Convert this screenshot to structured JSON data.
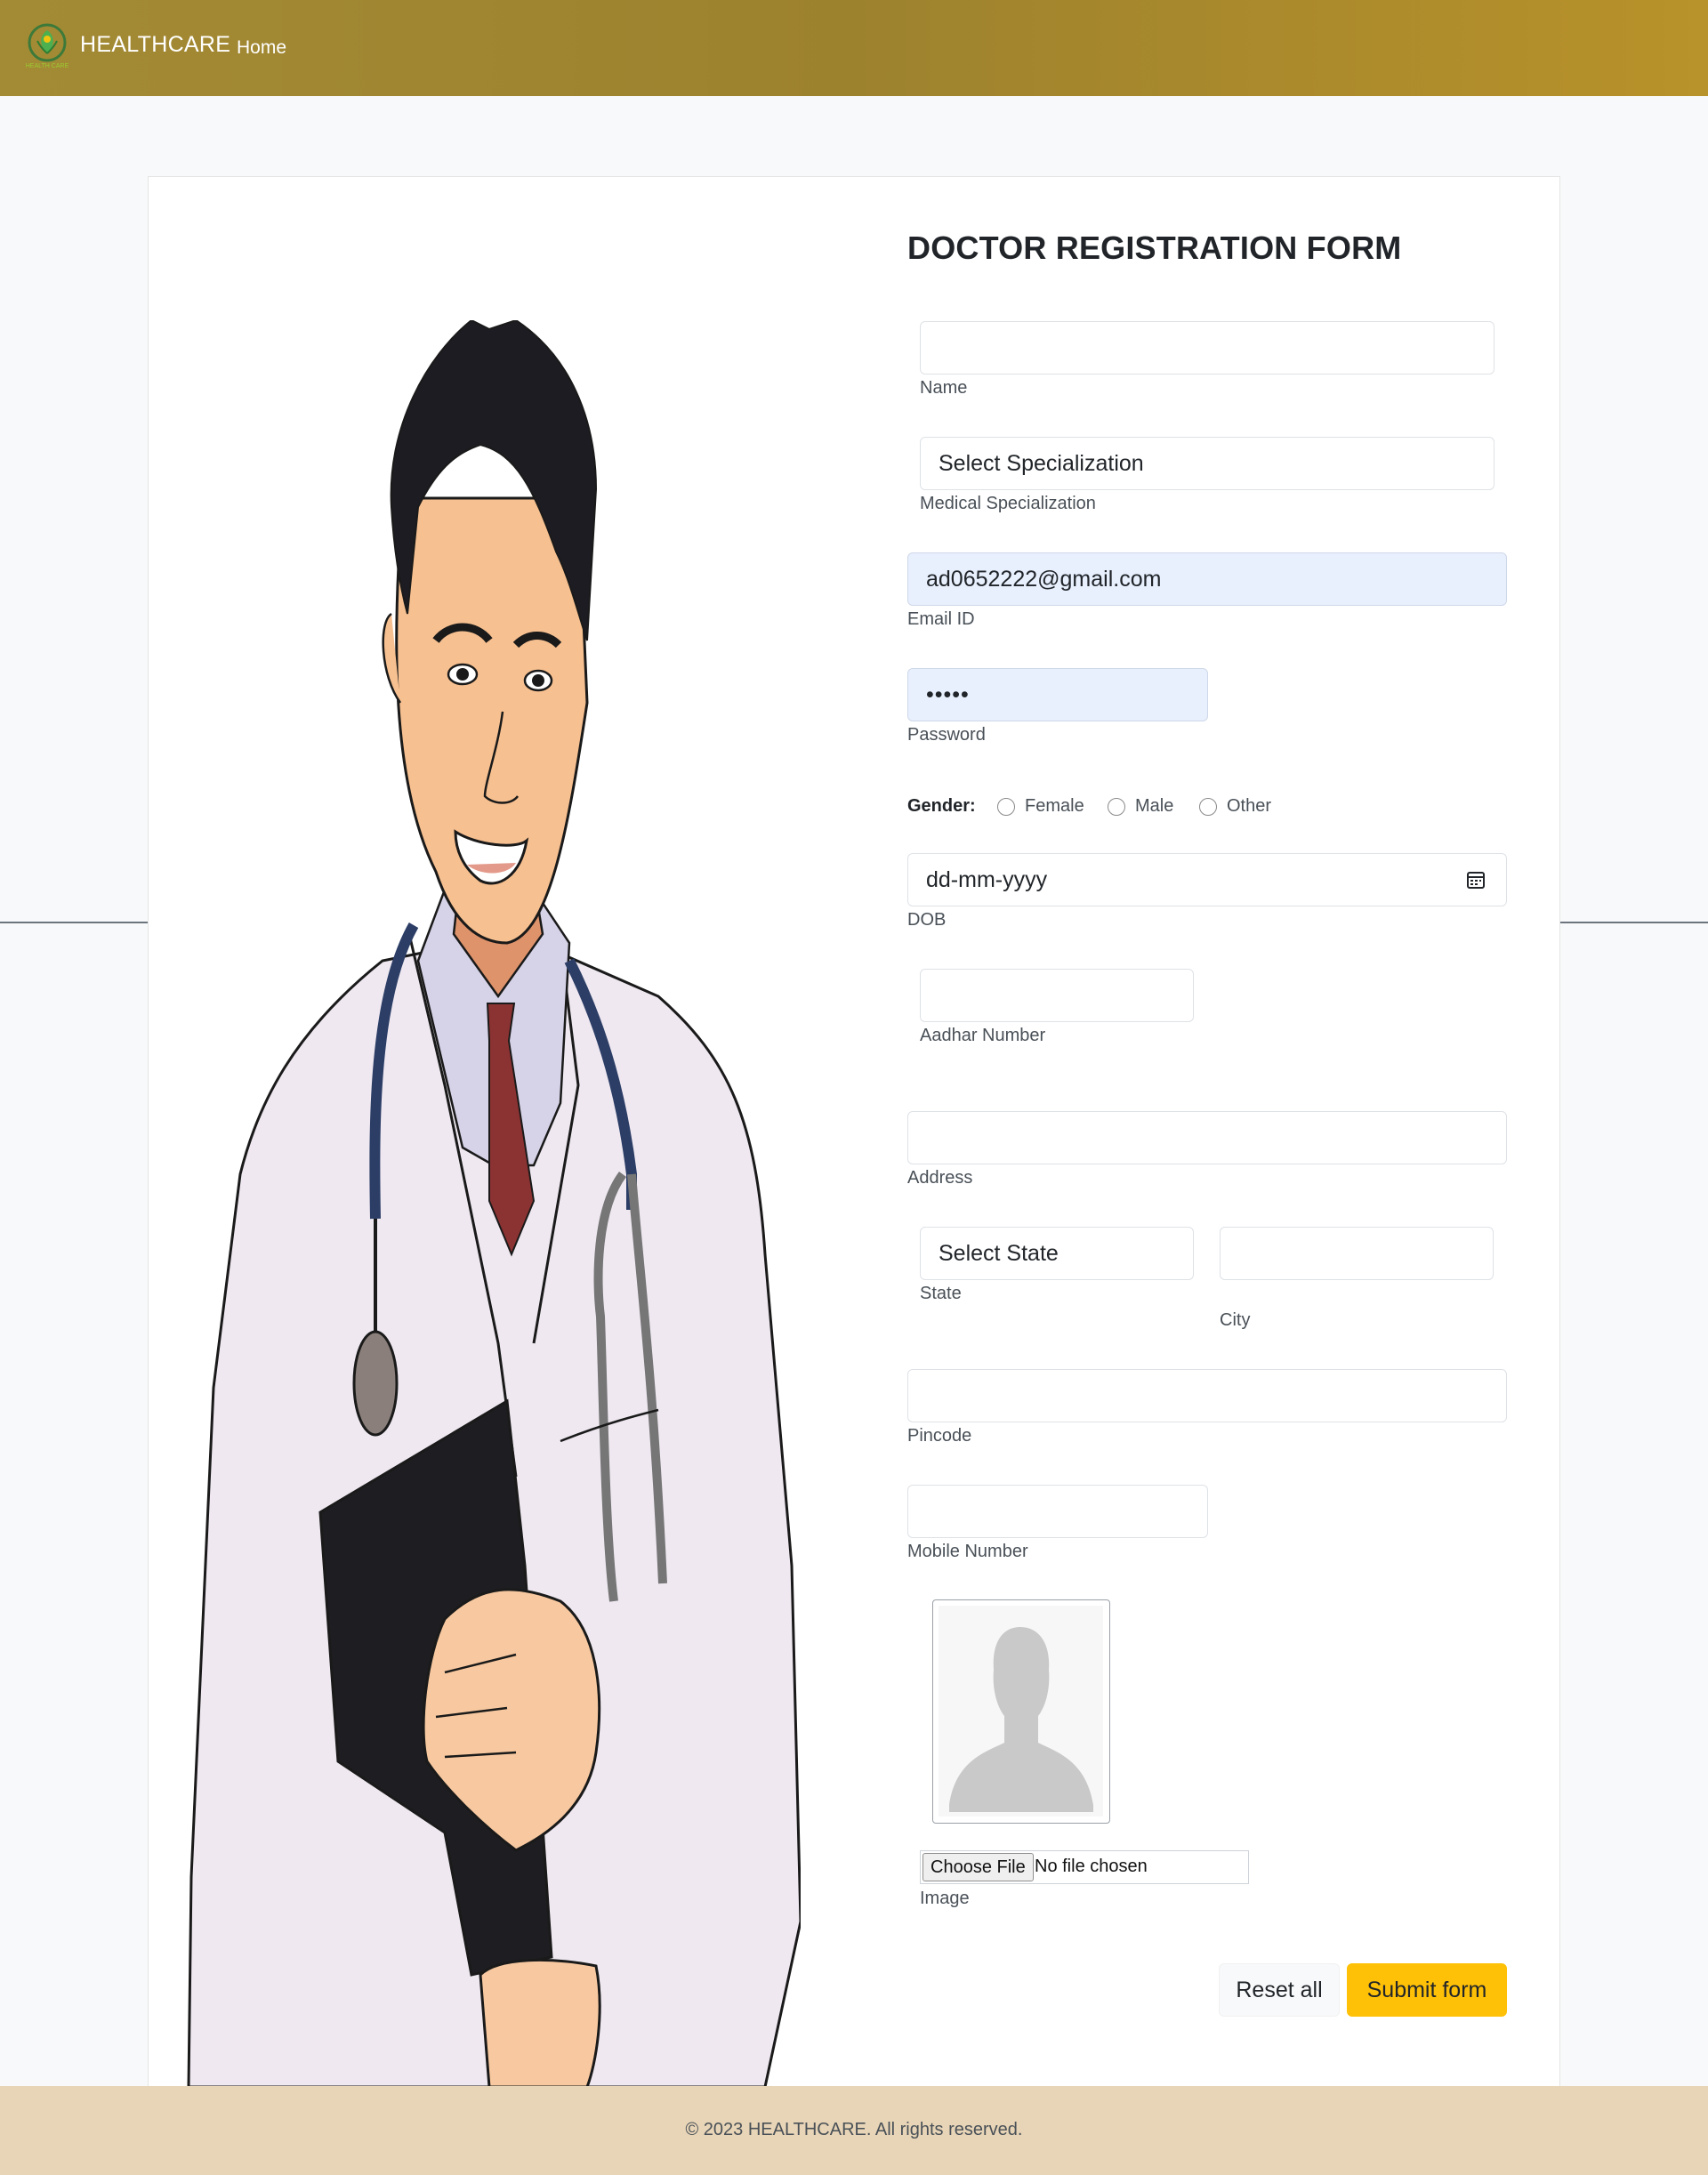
{
  "navbar": {
    "brand": "HEALTHCARE",
    "home_link": "Home",
    "logo_text": "HEALTH CARE",
    "background_color": "#a38a34"
  },
  "form": {
    "title": "DOCTOR REGISTRATION FORM",
    "name": {
      "value": "",
      "label": "Name"
    },
    "specialization": {
      "value": "Select Specialization",
      "label": "Medical Specialization"
    },
    "email": {
      "value": "ad0652222@gmail.com",
      "label": "Email ID"
    },
    "password": {
      "value": "•••••",
      "label": "Password"
    },
    "gender": {
      "label": "Gender:",
      "options": [
        "Female",
        "Male",
        "Other"
      ],
      "selected": null
    },
    "dob": {
      "placeholder": "dd-mm-yyyy",
      "label": "DOB",
      "icon": "calendar-icon"
    },
    "aadhar": {
      "value": "",
      "label": "Aadhar Number"
    },
    "address": {
      "value": "",
      "label": "Address"
    },
    "state": {
      "value": "Select State",
      "label": "State"
    },
    "city": {
      "value": "",
      "label": "City"
    },
    "pincode": {
      "value": "",
      "label": "Pincode"
    },
    "mobile": {
      "value": "",
      "label": "Mobile Number"
    },
    "image": {
      "choose_label": "Choose File",
      "status": "No file chosen",
      "label": "Image",
      "placeholder_icon": "avatar-placeholder-icon"
    },
    "buttons": {
      "reset": "Reset all",
      "submit": "Submit form"
    },
    "submit_color": "#ffc107",
    "autofill_color": "#e8f0fe"
  },
  "footer": {
    "text": "© 2023 HEALTHCARE. All rights reserved.",
    "background_color": "#e8d5b7"
  }
}
